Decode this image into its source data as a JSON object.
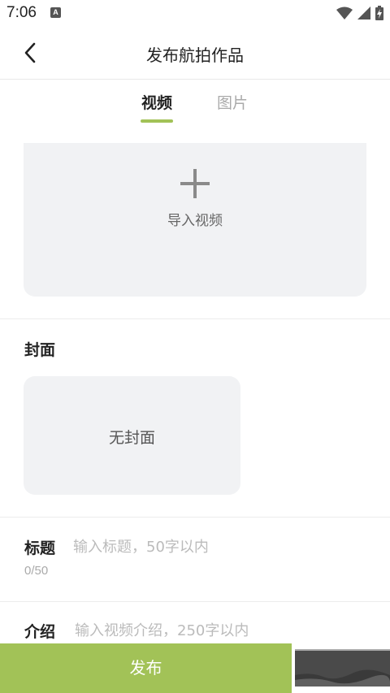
{
  "status_bar": {
    "time": "7:06",
    "notification_badge": "A",
    "icons": [
      "wifi-icon",
      "signal-icon",
      "battery-charging-icon"
    ]
  },
  "header": {
    "title": "发布航拍作品"
  },
  "tabs": [
    {
      "label": "视频",
      "active": true
    },
    {
      "label": "图片",
      "active": false
    }
  ],
  "import": {
    "label": "导入视频"
  },
  "cover": {
    "section_label": "封面",
    "empty_text": "无封面"
  },
  "title_field": {
    "label": "标题",
    "placeholder": "输入标题，50字以内",
    "value": "",
    "counter": "0/50"
  },
  "intro_field": {
    "label": "介绍",
    "placeholder": "输入视频介绍，250字以内",
    "value": ""
  },
  "publish": {
    "label": "发布"
  },
  "colors": {
    "accent": "#a2c257",
    "panel_bg": "#f1f2f4",
    "placeholder": "#bbbbbb"
  }
}
